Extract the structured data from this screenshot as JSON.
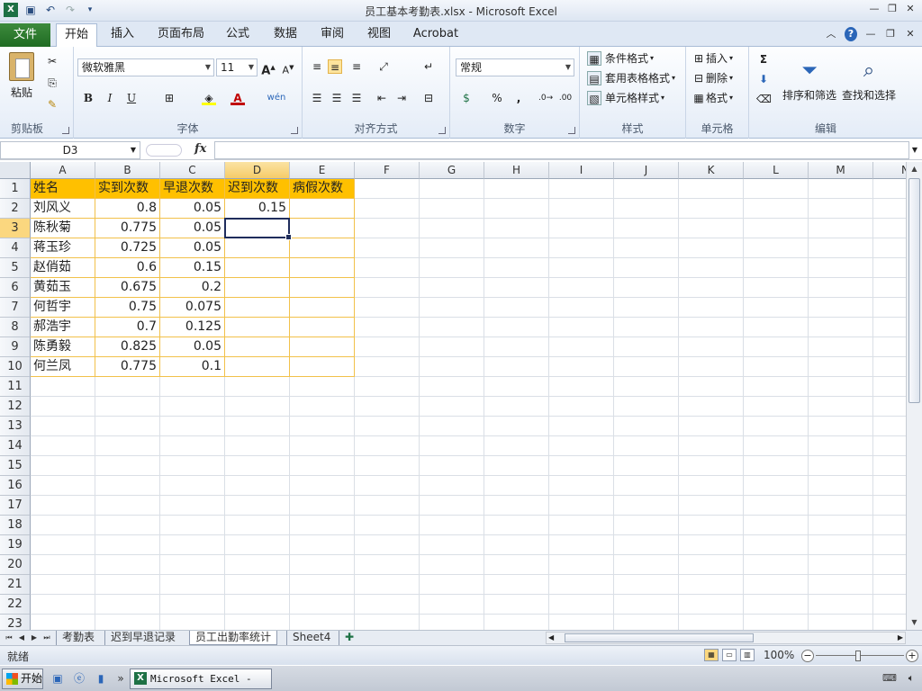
{
  "window": {
    "title": "员工基本考勤表.xlsx  -  Microsoft Excel"
  },
  "ribbon_tabs": {
    "file": "文件",
    "items": [
      "开始",
      "插入",
      "页面布局",
      "公式",
      "数据",
      "审阅",
      "视图",
      "Acrobat"
    ],
    "active": "开始"
  },
  "ribbon": {
    "clipboard": {
      "label": "剪贴板",
      "paste": "粘贴"
    },
    "font": {
      "label": "字体",
      "font_name": "微软雅黑",
      "font_size": "11",
      "bold": "B",
      "italic": "I",
      "underline": "U",
      "grow": "A",
      "shrink": "A",
      "font_color": "A",
      "wen": "wén"
    },
    "alignment": {
      "label": "对齐方式"
    },
    "number": {
      "label": "数字",
      "format": "常规",
      "percent": "%",
      "comma": ","
    },
    "styles": {
      "label": "样式",
      "conditional": "条件格式",
      "table": "套用表格格式",
      "cell_styles": "单元格样式"
    },
    "cells": {
      "label": "单元格",
      "insert": "插入",
      "delete": "删除",
      "format": "格式"
    },
    "editing": {
      "label": "编辑",
      "sigma": "Σ",
      "sort_filter": "排序和筛选",
      "find_select": "查找和选择"
    }
  },
  "formula_bar": {
    "name_box": "D3",
    "fx": "fx",
    "formula": ""
  },
  "grid": {
    "columns": [
      "A",
      "B",
      "C",
      "D",
      "E",
      "F",
      "G",
      "H",
      "I",
      "J",
      "K",
      "L",
      "M",
      "N"
    ],
    "selected_column": "D",
    "rows": [
      "1",
      "2",
      "3",
      "4",
      "5",
      "6",
      "7",
      "8",
      "9",
      "10",
      "11",
      "12",
      "13",
      "14",
      "15",
      "16",
      "17",
      "18",
      "19",
      "20",
      "21",
      "22",
      "23"
    ],
    "selected_row": "3",
    "selected_cell": "D3",
    "header": [
      "姓名",
      "实到次数",
      "早退次数",
      "迟到次数",
      "病假次数"
    ],
    "data": [
      [
        "刘风义",
        "0.8",
        "0.05",
        "0.15",
        ""
      ],
      [
        "陈秋菊",
        "0.775",
        "0.05",
        "",
        ""
      ],
      [
        "蒋玉珍",
        "0.725",
        "0.05",
        "",
        ""
      ],
      [
        "赵俏茹",
        "0.6",
        "0.15",
        "",
        ""
      ],
      [
        "黄茹玉",
        "0.675",
        "0.2",
        "",
        ""
      ],
      [
        "何哲宇",
        "0.75",
        "0.075",
        "",
        ""
      ],
      [
        "郝浩宇",
        "0.7",
        "0.125",
        "",
        ""
      ],
      [
        "陈勇毅",
        "0.825",
        "0.05",
        "",
        ""
      ],
      [
        "何兰凤",
        "0.775",
        "0.1",
        "",
        ""
      ]
    ],
    "header_color": "#ffc000",
    "table_border_color": "#f2c14a"
  },
  "sheet_tabs": {
    "items": [
      "考勤表",
      "迟到早退记录",
      "员工出勤率统计",
      "Sheet4"
    ],
    "active": "员工出勤率统计"
  },
  "statusbar": {
    "status": "就绪",
    "zoom": "100%"
  },
  "taskbar": {
    "start": "开始",
    "excel_task": "Microsoft Excel - ..."
  }
}
